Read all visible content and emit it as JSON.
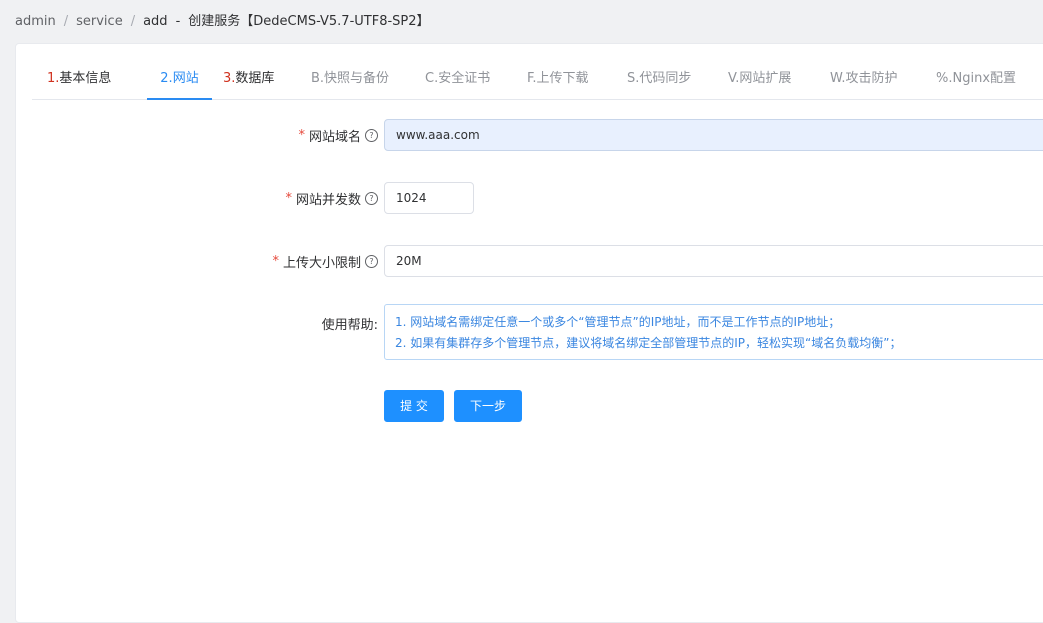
{
  "breadcrumb": {
    "items": [
      "admin",
      "service",
      "add"
    ],
    "separator": "/",
    "title_separator": "-",
    "title": "创建服务【DedeCMS-V5.7-UTF8-SP2】"
  },
  "tabs": [
    {
      "num": "1.",
      "text": "基本信息",
      "state": "enabled"
    },
    {
      "num": "2.",
      "text": "网站",
      "state": "active"
    },
    {
      "num": "3.",
      "text": "数据库",
      "state": "enabled"
    },
    {
      "num": "",
      "text": "B.快照与备份",
      "state": "disabled"
    },
    {
      "num": "",
      "text": "C.安全证书",
      "state": "disabled"
    },
    {
      "num": "",
      "text": "F.上传下载",
      "state": "disabled"
    },
    {
      "num": "",
      "text": "S.代码同步",
      "state": "disabled"
    },
    {
      "num": "",
      "text": "V.网站扩展",
      "state": "disabled"
    },
    {
      "num": "",
      "text": "W.攻击防护",
      "state": "disabled"
    },
    {
      "num": "",
      "text": "%.Nginx配置",
      "state": "disabled"
    }
  ],
  "form": {
    "required_mark": "*",
    "help_icon": "?",
    "domain": {
      "label": "网站域名",
      "value": "www.aaa.com"
    },
    "concurrency": {
      "label": "网站并发数",
      "value": "1024"
    },
    "upload_limit": {
      "label": "上传大小限制",
      "value": "20M"
    },
    "help": {
      "label": "使用帮助:",
      "lines": [
        "1. 网站域名需绑定任意一个或多个“管理节点”的IP地址，而不是工作节点的IP地址；",
        "2. 如果有集群存多个管理节点，建议将域名绑定全部管理节点的IP，轻松实现“域名负载均衡”；"
      ]
    }
  },
  "buttons": {
    "submit": "提 交",
    "next": "下一步"
  },
  "colors": {
    "accent": "#2a8bf2",
    "step_number": "#d0321f",
    "required": "#e5483b",
    "button": "#1e90ff"
  }
}
